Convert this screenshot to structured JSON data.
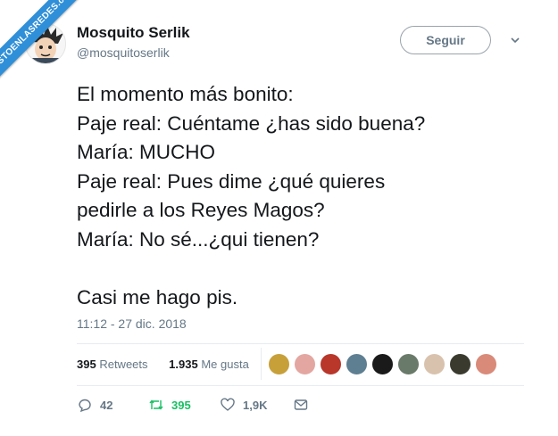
{
  "watermark": "VISTOENLASREDES.com",
  "user": {
    "name": "Mosquito Serlik",
    "handle": "@mosquitoserlik"
  },
  "follow_label": "Seguir",
  "tweet": {
    "lines": [
      "El momento más bonito:",
      "Paje real: Cuéntame ¿has sido buena?",
      "María: MUCHO",
      "Paje real: Pues dime ¿qué quieres",
      "pedirle a los Reyes Magos?",
      "María: No sé...¿qui tienen?",
      "",
      "Casi me hago pis."
    ],
    "timestamp": "11:12 - 27 dic. 2018"
  },
  "stats": {
    "retweets_count": "395",
    "retweets_label": "Retweets",
    "likes_count": "1.935",
    "likes_label": "Me gusta"
  },
  "actions": {
    "replies": "42",
    "retweets": "395",
    "likes": "1,9K"
  },
  "colors": {
    "retweet_green": "#17bf63",
    "text": "#14171a",
    "muted": "#657786",
    "ribbon": "#2f8fd8"
  },
  "liker_colors": [
    "#c7a03a",
    "#e3a6a0",
    "#b8362a",
    "#5e7f92",
    "#1a1a1a",
    "#6a7a6a",
    "#d9c2ad",
    "#3a3a2e",
    "#d98a78"
  ]
}
